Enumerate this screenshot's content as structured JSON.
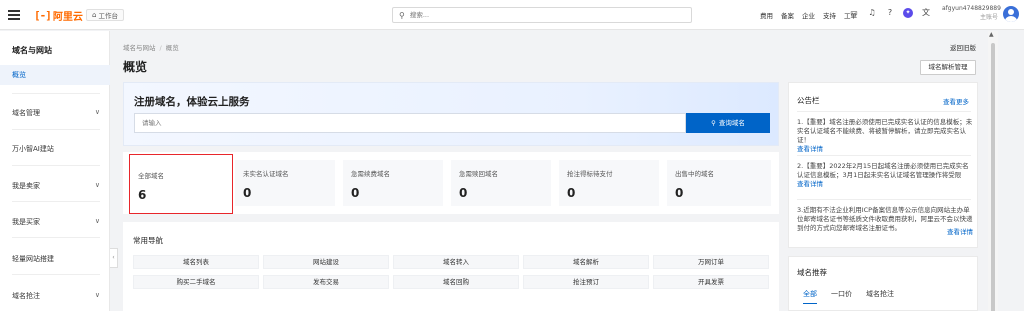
{
  "topbar": {
    "logo_mark": "[-]",
    "logo_text": "阿里云",
    "workbench_label": "工作台",
    "search_placeholder": "搜索...",
    "links": [
      "费用",
      "备案",
      "企业",
      "支持",
      "工单"
    ],
    "icons": [
      "screen-icon",
      "bell-icon",
      "help-icon",
      "ai-assistant-icon",
      "language-icon"
    ],
    "account": "afgyun4748829889",
    "role": "主账号"
  },
  "sidebar": {
    "title": "域名与网站",
    "active_item": "概览",
    "items": [
      {
        "label": "域名管理",
        "chevron": true
      },
      {
        "label": "万小智AI建站",
        "chevron": false
      },
      {
        "label": "我是卖家",
        "chevron": true
      },
      {
        "label": "我是买家",
        "chevron": true
      },
      {
        "label": "轻量网站搭建",
        "chevron": false
      },
      {
        "label": "域名抢注",
        "chevron": true
      }
    ],
    "collapse_glyph": "‹"
  },
  "breadcrumb": {
    "parent": "域名与网站",
    "separator": "/",
    "current": "概览"
  },
  "page": {
    "title": "概览",
    "back_old_label": "返回旧版",
    "dns_button_label": "域名解析管理"
  },
  "register": {
    "title": "注册域名，体验云上服务",
    "input_placeholder": "请输入",
    "search_button_label": "查询域名"
  },
  "stats": [
    {
      "label": "全部域名",
      "value": "6",
      "selected": true
    },
    {
      "label": "未实名认证域名",
      "value": "0",
      "selected": false
    },
    {
      "label": "急需续费域名",
      "value": "0",
      "selected": false
    },
    {
      "label": "急需赎回域名",
      "value": "0",
      "selected": false
    },
    {
      "label": "抢注得标待支付",
      "value": "0",
      "selected": false
    },
    {
      "label": "出售中的域名",
      "value": "0",
      "selected": false
    }
  ],
  "quick_nav": {
    "title": "常用导航",
    "rows": [
      [
        "域名列表",
        "网站建设",
        "域名转入",
        "域名解析",
        "万网订单"
      ],
      [
        "购买二手域名",
        "发布交易",
        "域名回购",
        "抢注预订",
        "开具发票"
      ]
    ]
  },
  "announcements": {
    "title": "公告栏",
    "more_label": "查看更多",
    "items": [
      {
        "text": "1.【重要】域名注册必须使用已完成实名认证的信息模板；未实名认证域名不能续费、将被暂停解析，请立即完成实名认证！",
        "link": "查看详情"
      },
      {
        "text": "2.【重要】2022年2月15日起域名注册必须使用已完成实名认证信息模板；3月1日起未实名认证域名管理操作将受限",
        "link": "查看详情"
      },
      {
        "text": "3.近期有不法企业利用ICP备案信息等公示信息向网站主办单位邮寄域名证书等纸质文件收取费用获利，阿里云不会以快递到付的方式向您邮寄域名注册证书。",
        "link": "查看详情"
      }
    ]
  },
  "recommend": {
    "title": "域名推荐",
    "tabs": [
      "全部",
      "一口价",
      "域名抢注"
    ],
    "active_tab": "全部"
  },
  "colors": {
    "brand": "#ff6a00",
    "primary": "#0064c8",
    "highlight_border": "#e8262b"
  }
}
